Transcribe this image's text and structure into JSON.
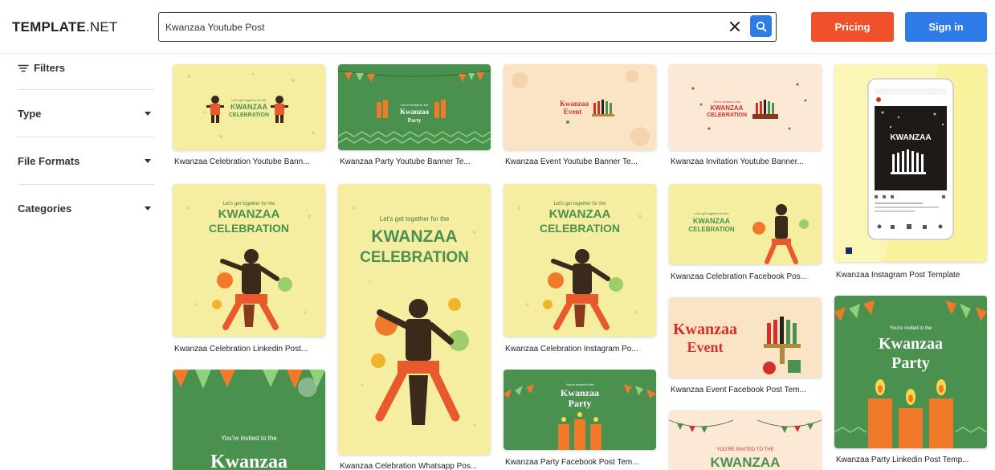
{
  "header": {
    "logo_bold": "TEMPLATE",
    "logo_light": ".NET",
    "search_value": "Kwanzaa Youtube Post",
    "pricing_label": "Pricing",
    "signin_label": "Sign in"
  },
  "sidebar": {
    "filters_label": "Filters",
    "sections": [
      "Type",
      "File Formats",
      "Categories"
    ]
  },
  "cards": [
    {
      "title": "Kwanzaa Celebration Youtube Bann..."
    },
    {
      "title": "Kwanzaa Party Youtube Banner Te..."
    },
    {
      "title": "Kwanzaa Event Youtube Banner Te..."
    },
    {
      "title": "Kwanzaa Invitation Youtube Banner..."
    },
    {
      "title": "Kwanzaa Instagram Post Template"
    },
    {
      "title": "Kwanzaa Celebration Linkedin Post..."
    },
    {
      "title": "Kwanzaa Celebration Whatsapp Pos..."
    },
    {
      "title": "Kwanzaa Celebration Instagram Po..."
    },
    {
      "title": "Kwanzaa Celebration Facebook Pos..."
    },
    {
      "title": "Kwanzaa Event Facebook Post Tem..."
    },
    {
      "title": "Kwanzaa Party Facebook Post Tem..."
    },
    {
      "title": "Kwanzaa Party Linkedin Post Temp..."
    }
  ],
  "thumbnail_text": {
    "lets_get_together": "Let's get together for the",
    "kwanzaa_upper": "KWANZAA",
    "celebration_upper": "CELEBRATION",
    "kwanzaa": "Kwanzaa",
    "party": "Party",
    "event": "Event",
    "youre_invited": "You're invited to the",
    "youre_invited_upper": "YOU'RE INVITED TO THE"
  },
  "colors": {
    "green": "#4a9150",
    "yellow": "#f5eea0",
    "peach": "#fbe4c5",
    "orange": "#f0502a",
    "blue": "#2f7ce8"
  }
}
